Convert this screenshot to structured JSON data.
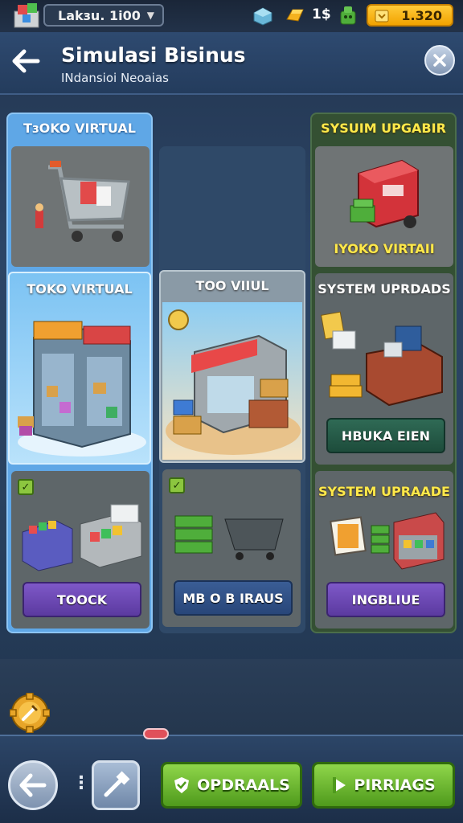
{
  "status_bar": {
    "level_label": "Lakзu. 1i00",
    "cash_label": "1$",
    "coins_value": "1.320"
  },
  "header": {
    "title": "Simulasi Bisinus",
    "subtitle": "INdansioi Neoaias"
  },
  "columns": [
    {
      "cards": [
        {
          "label": "TɜOKO VIRTUAL"
        },
        {
          "label": "TOKO VIRTUAL"
        },
        {
          "button": "TOOCK"
        }
      ]
    },
    {
      "cards": [
        {
          "label": "TOO VIIUL"
        },
        {
          "button": "MB O B IRAUS"
        }
      ]
    },
    {
      "cards": [
        {
          "label": "SYSUIM UPGABIR",
          "caption": "IYOKO VIRTAII"
        },
        {
          "label": "SYSTEM UPRDADS",
          "button": "HBUKA EIEN"
        },
        {
          "label": "SYSTEM UPRAADE",
          "button": "INGBLIUE"
        }
      ]
    }
  ],
  "bottom_bar": {
    "upgrade_button": "OPDRAALS",
    "parking_button": "PIRRIAGS"
  },
  "colors": {
    "accent_green": "#6fbf2e",
    "coin_gold": "#f2a300",
    "header_blue": "#2e4a70"
  }
}
